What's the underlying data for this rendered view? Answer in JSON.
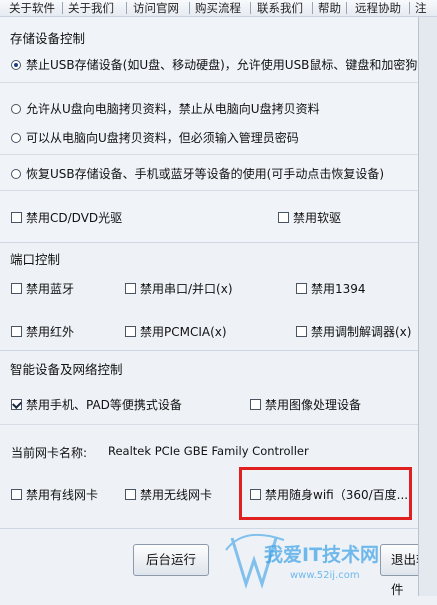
{
  "menu": {
    "items": [
      "关于软件",
      "关于我们",
      "访问官网",
      "购买流程",
      "联系我们",
      "帮助",
      "远程协助",
      "注"
    ]
  },
  "storage": {
    "title": "存储设备控制",
    "options": [
      {
        "label": "禁止USB存储设备(如U盘、移动硬盘)，允许使用USB鼠标、键盘和加密狗",
        "checked": true
      },
      {
        "label": "允许从U盘向电脑拷贝资料，禁止从电脑向U盘拷贝资料",
        "checked": false
      },
      {
        "label": "可以从电脑向U盘拷贝资料，但必须输入管理员密码",
        "checked": false
      },
      {
        "label": "恢复USB存储设备、手机或蓝牙等设备的使用(可手动点击恢复设备)",
        "checked": false
      }
    ],
    "cd_label": "禁用CD/DVD光驱",
    "floppy_label": "禁用软驱"
  },
  "ports": {
    "title": "端口控制",
    "bluetooth": "禁用蓝牙",
    "serial": "禁用串口/并口(x)",
    "ieee1394": "禁用1394",
    "infrared": "禁用红外",
    "pcmcia": "禁用PCMCIA(x)",
    "modem": "禁用调制解调器(x)"
  },
  "smart": {
    "title": "智能设备及网络控制",
    "phone": {
      "label": "禁用手机、PAD等便携式设备",
      "checked": true
    },
    "imaging": {
      "label": "禁用图像处理设备",
      "checked": false
    },
    "nic_label": "当前网卡名称:",
    "nic_value": "Realtek PCIe GBE Family Controller",
    "wired": "禁用有线网卡",
    "wireless": "禁用无线网卡",
    "wifi": "禁用随身wifi（360/百度..."
  },
  "buttons": {
    "background": "后台运行",
    "exit": "退出软件"
  },
  "watermark": {
    "text": "我爱IT技术网",
    "url": "www.52ij.com"
  },
  "colors": {
    "highlight": "#e0201e",
    "watermark": "#3aa0e6"
  }
}
